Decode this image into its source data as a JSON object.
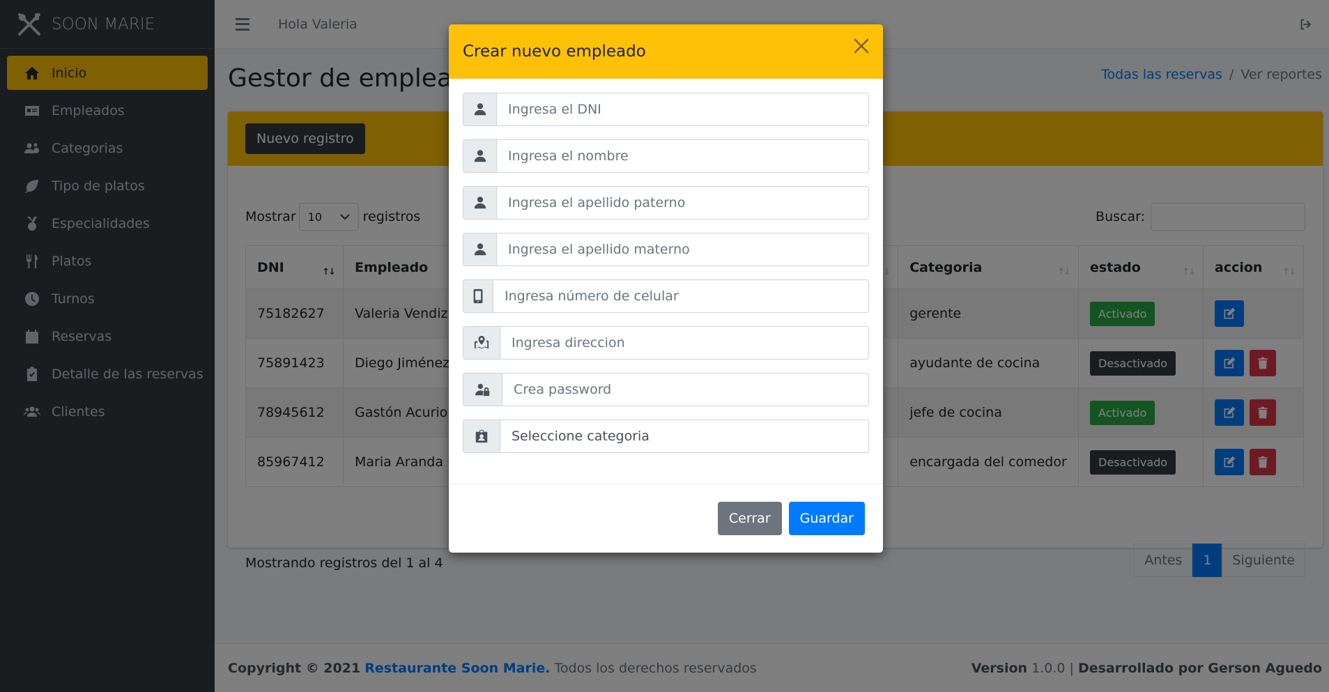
{
  "brand": {
    "name": "SOON MARIE"
  },
  "sidebar": {
    "items": [
      {
        "label": "Inicio",
        "icon": "home-icon",
        "active": true
      },
      {
        "label": "Empleados",
        "icon": "id-card-icon"
      },
      {
        "label": "Categorias",
        "icon": "users-cog-icon"
      },
      {
        "label": "Tipo de platos",
        "icon": "leaf-icon"
      },
      {
        "label": "Especialidades",
        "icon": "medal-icon"
      },
      {
        "label": "Platos",
        "icon": "utensils-icon"
      },
      {
        "label": "Turnos",
        "icon": "clock-icon"
      },
      {
        "label": "Reservas",
        "icon": "calendar-icon"
      },
      {
        "label": "Detalle de las reservas",
        "icon": "clipboard-check-icon"
      },
      {
        "label": "Clientes",
        "icon": "users-icon"
      }
    ]
  },
  "header": {
    "greeting": "Hola Valeria"
  },
  "page": {
    "title": "Gestor de empleados",
    "breadcrumb": {
      "link": "Todas las reservas",
      "separator": "/",
      "current": "Ver reportes"
    },
    "new_button": "Nuevo registro"
  },
  "table": {
    "show_label": "Mostrar",
    "show_value": "10",
    "records_label": "registros",
    "search_label": "Buscar:",
    "columns": [
      "DNI",
      "Empleado",
      "Categoria",
      "estado",
      "accion"
    ],
    "rows": [
      {
        "dni": "75182627",
        "empleado": "Valeria Vendizú C",
        "categoria": "gerente",
        "estado": "Activado"
      },
      {
        "dni": "75891423",
        "empleado": "Diego Jiménez S",
        "categoria": "ayudante de cocina",
        "estado": "Desactivado"
      },
      {
        "dni": "78945612",
        "empleado": "Gastón Acurio Lo",
        "categoria": "jefe de cocina",
        "estado": "Activado"
      },
      {
        "dni": "85967412",
        "empleado": "Maria Aranda Ba",
        "categoria": "encargada del comedor",
        "estado": "Desactivado"
      }
    ],
    "info": "Mostrando registros del 1 al 4",
    "pager": {
      "prev": "Antes",
      "current": "1",
      "next": "Siguiente"
    }
  },
  "footer": {
    "copyright": "Copyright © 2021",
    "company": "Restaurante Soon Marie.",
    "rights": "Todos los derechos reservados",
    "version_label": "Version",
    "version": "1.0.0",
    "dev": "Desarrollado por Gerson Agu­edo"
  },
  "modal": {
    "title": "Crear nuevo empleado",
    "fields": [
      {
        "placeholder": "Ingresa el DNI",
        "icon": "user-icon"
      },
      {
        "placeholder": "Ingresa el nombre",
        "icon": "user-icon"
      },
      {
        "placeholder": "Ingresa el apellido paterno",
        "icon": "user-icon"
      },
      {
        "placeholder": "Ingresa el apellido materno",
        "icon": "user-icon"
      },
      {
        "placeholder": "Ingresa número de celular",
        "icon": "mobile-icon"
      },
      {
        "placeholder": "Ingresa direccion",
        "icon": "map-marked-icon"
      },
      {
        "placeholder": "Crea password",
        "icon": "user-lock-icon"
      },
      {
        "placeholder": "Seleccione categoria",
        "icon": "id-badge-icon"
      }
    ],
    "close_button": "Cerrar",
    "save_button": "Guardar"
  },
  "colors": {
    "accent": "#ffc107",
    "sidebar": "#343a40",
    "primary": "#007bff",
    "success": "#28a745",
    "danger": "#dc3545"
  }
}
